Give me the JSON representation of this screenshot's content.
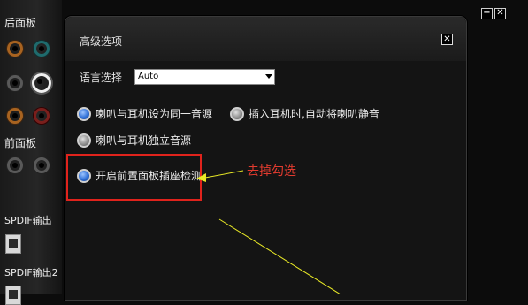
{
  "left_panel": {
    "rear_label": "后面板",
    "front_label": "前面板",
    "spdif_out_label": "SPDIF输出",
    "spdif_out2_label": "SPDIF输出2"
  },
  "window_controls": {
    "minimize": "−",
    "close": "✕"
  },
  "dialog": {
    "title": "高级选项",
    "close_glyph": "✕",
    "language": {
      "label": "语言选择",
      "value": "Auto"
    },
    "options": [
      {
        "label": "喇叭与耳机设为同一音源",
        "selected": true
      },
      {
        "label": "插入耳机时,自动将喇叭静音",
        "selected": false
      },
      {
        "label": "喇叭与耳机独立音源",
        "selected": false
      },
      {
        "label": "开启前置面板插座检测",
        "selected": true
      }
    ]
  },
  "annotation": {
    "text": "去掉勾选",
    "color": "#e23b2f"
  },
  "colors": {
    "radio_selected": "#2f6fd6",
    "highlight_box": "#e0231c",
    "arrow": "#e8e826"
  }
}
